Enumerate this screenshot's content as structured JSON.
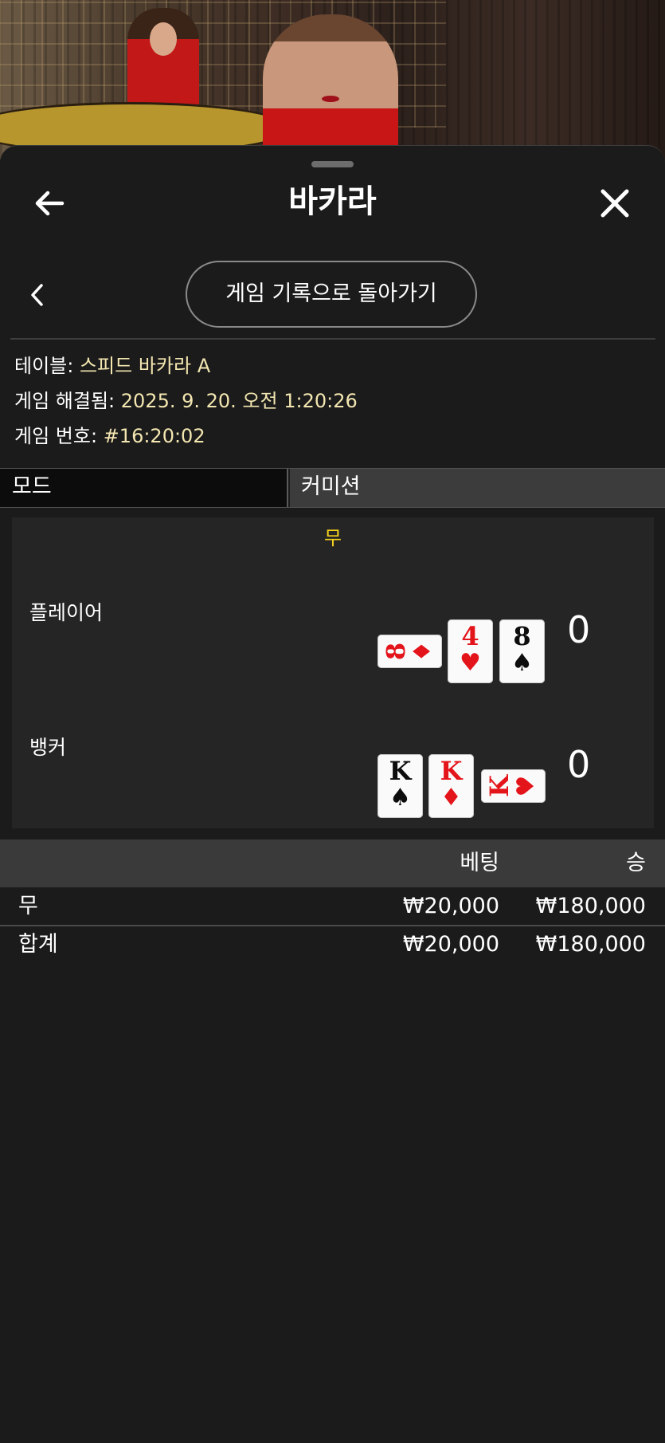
{
  "header": {
    "title": "바카라",
    "back_button": "back-arrow",
    "close_button": "close"
  },
  "history_button_label": "게임 기록으로 돌아가기",
  "info": {
    "table_label": "테이블:",
    "table_value": "스피드 바카라 A",
    "resolved_label": "게임 해결됨:",
    "resolved_value": "2025. 9. 20. 오전 1:20:26",
    "game_no_label": "게임 번호:",
    "game_no_value": "#16:20:02"
  },
  "mode": {
    "label": "모드",
    "value": "커미션"
  },
  "result": {
    "outcome": "무",
    "player": {
      "label": "플레이어",
      "score": "0",
      "cards": [
        {
          "rank": "8",
          "suit": "♦",
          "color": "#e4141b",
          "rotated": true
        },
        {
          "rank": "4",
          "suit": "♥",
          "color": "#e4141b",
          "rotated": false
        },
        {
          "rank": "8",
          "suit": "♠",
          "color": "#0d0d0d",
          "rotated": false
        }
      ]
    },
    "banker": {
      "label": "뱅커",
      "score": "0",
      "cards": [
        {
          "rank": "K",
          "suit": "♠",
          "color": "#0d0d0d",
          "rotated": false
        },
        {
          "rank": "K",
          "suit": "♦",
          "color": "#e4141b",
          "rotated": false
        },
        {
          "rank": "K",
          "suit": "♥",
          "color": "#e4141b",
          "rotated": true
        }
      ]
    }
  },
  "bets": {
    "headers": {
      "bet": "베팅",
      "win": "승"
    },
    "rows": [
      {
        "name": "무",
        "bet": "₩20,000",
        "win": "₩180,000"
      }
    ],
    "total": {
      "name": "합계",
      "bet": "₩20,000",
      "win": "₩180,000"
    }
  },
  "colors": {
    "background": "#1b1b1b",
    "panel": "#252525",
    "outcome": "#f5d21b",
    "info_value": "#f3e6b0",
    "card_red": "#e4141b"
  }
}
